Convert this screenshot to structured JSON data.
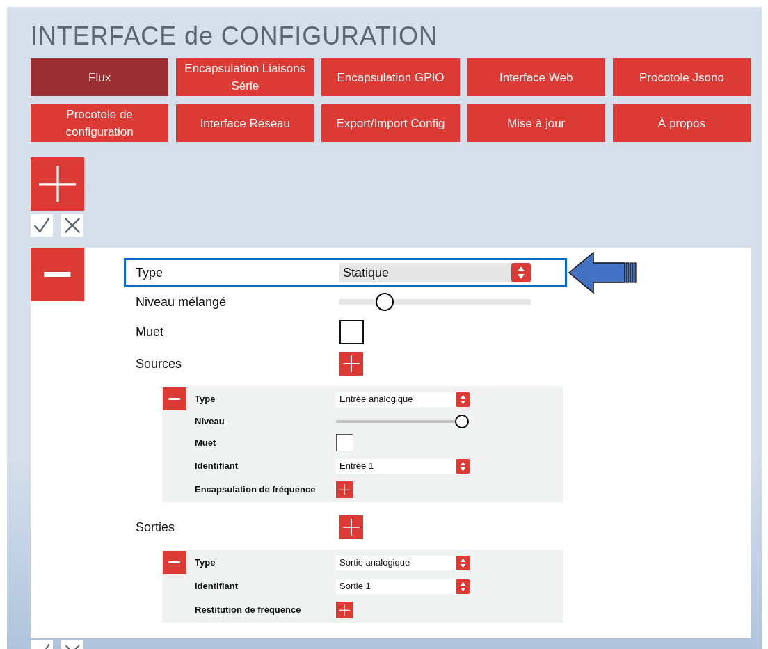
{
  "title": "INTERFACE de CONFIGURATION",
  "tabs": [
    {
      "label": "Flux",
      "selected": true
    },
    {
      "label": "Encapsulation Liaisons Série",
      "selected": false
    },
    {
      "label": "Encapsulation GPIO",
      "selected": false
    },
    {
      "label": "Interface Web",
      "selected": false
    },
    {
      "label": "Procotole Jsono",
      "selected": false
    },
    {
      "label": "Procotole de configuration",
      "selected": false
    },
    {
      "label": "Interface Réseau",
      "selected": false
    },
    {
      "label": "Export/Import Config",
      "selected": false
    },
    {
      "label": "Mise à jour",
      "selected": false
    },
    {
      "label": "À propos",
      "selected": false
    }
  ],
  "stream": {
    "fields": [
      {
        "kind": "select",
        "label": "Type",
        "value": "Statique",
        "highlighted": true
      },
      {
        "kind": "slider",
        "label": "Niveau mélangé",
        "level": 0.21
      },
      {
        "kind": "checkbox",
        "label": "Muet",
        "checked": false
      },
      {
        "kind": "list",
        "label": "Sources",
        "items": [
          {
            "fields": [
              {
                "kind": "select",
                "label": "Type",
                "value": "Entrée analogique"
              },
              {
                "kind": "slider",
                "label": "Niveau",
                "level": 1.0
              },
              {
                "kind": "checkbox",
                "label": "Muet",
                "checked": false
              },
              {
                "kind": "select",
                "label": "Identifiant",
                "value": "Entrée 1"
              },
              {
                "kind": "add",
                "label": "Encapsulation de fréquence"
              }
            ]
          }
        ]
      },
      {
        "kind": "list",
        "label": "Sorties",
        "items": [
          {
            "fields": [
              {
                "kind": "select",
                "label": "Type",
                "value": "Sortie analogique"
              },
              {
                "kind": "select",
                "label": "Identifiant",
                "value": "Sortie 1"
              },
              {
                "kind": "add",
                "label": "Restitution de fréquence"
              }
            ]
          }
        ]
      }
    ]
  }
}
